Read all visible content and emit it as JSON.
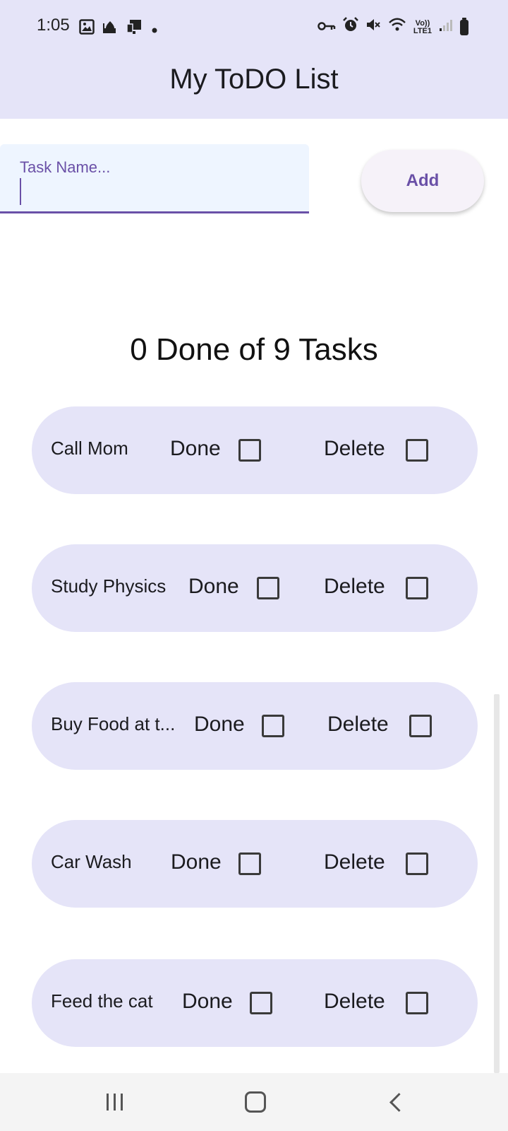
{
  "status_bar": {
    "time": "1:05",
    "left_icons": [
      "gallery-icon",
      "mosque-icon",
      "cast-device-icon",
      "dot-icon"
    ],
    "right_icons": [
      "vpn-key-icon",
      "alarm-icon",
      "mute-icon",
      "wifi-icon",
      "volte-icon",
      "signal-icon",
      "battery-icon"
    ],
    "lte_top": "Vo))",
    "lte_bottom": "LTE1"
  },
  "app_bar": {
    "title": "My ToDO List"
  },
  "input": {
    "label": "Task Name...",
    "value": ""
  },
  "add_button": {
    "label": "Add"
  },
  "summary": {
    "text": "0 Done of 9 Tasks"
  },
  "tasks": [
    {
      "name": "Call Mom",
      "done_label": "Done",
      "delete_label": "Delete",
      "done": false,
      "delete": false
    },
    {
      "name": "Study Physics",
      "done_label": "Done",
      "delete_label": "Delete",
      "done": false,
      "delete": false
    },
    {
      "name": "Buy Food at t...",
      "done_label": "Done",
      "delete_label": "Delete",
      "done": false,
      "delete": false
    },
    {
      "name": "Car Wash",
      "done_label": "Done",
      "delete_label": "Delete",
      "done": false,
      "delete": false
    },
    {
      "name": "Feed the cat",
      "done_label": "Done",
      "delete_label": "Delete",
      "done": false,
      "delete": false
    }
  ],
  "nav_bar": {
    "buttons": [
      "recents-icon",
      "home-icon",
      "back-icon"
    ]
  },
  "colors": {
    "accent": "#6a50a7",
    "card_background": "#e5e4f8",
    "input_background": "#eef5ff"
  }
}
